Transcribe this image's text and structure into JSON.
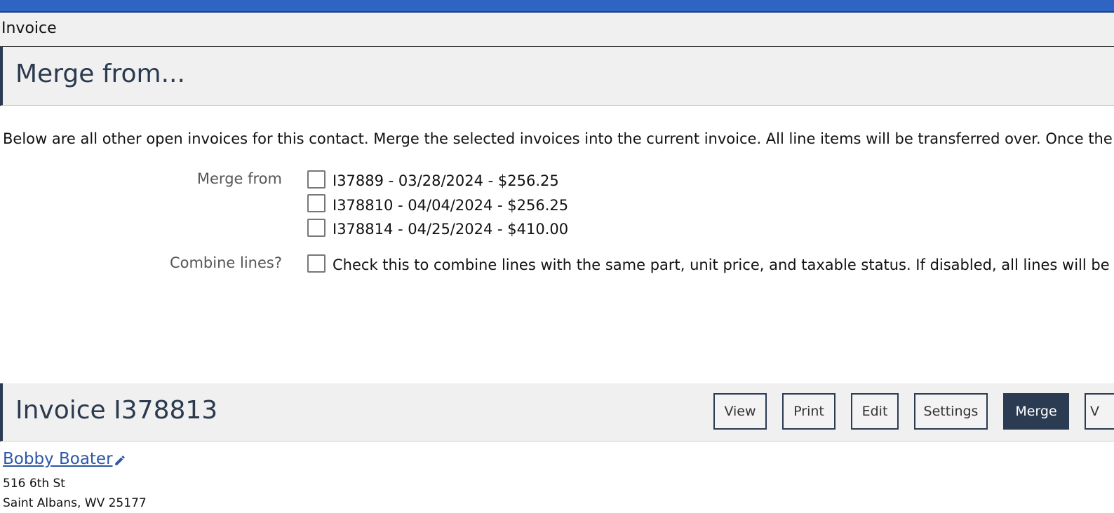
{
  "window": {
    "tab_title": "Invoice"
  },
  "merge_section": {
    "title": "Merge from...",
    "description": "Below are all other open invoices for this contact. Merge the selected invoices into the current invoice. All line items will be transferred over. Once the mer",
    "merge_from_label": "Merge from",
    "invoices": [
      {
        "label": "I37889 - 03/28/2024 - $256.25",
        "checked": false
      },
      {
        "label": "I378810 - 04/04/2024 - $256.25",
        "checked": false
      },
      {
        "label": "I378814 - 04/25/2024 - $410.00",
        "checked": false
      }
    ],
    "combine_label": "Combine lines?",
    "combine_text": "Check this to combine lines with the same part, unit price, and taxable status. If disabled, all lines will be ad"
  },
  "invoice_section": {
    "title": "Invoice I378813",
    "buttons": {
      "view": "View",
      "print": "Print",
      "edit": "Edit",
      "settings": "Settings",
      "merge": "Merge",
      "partial": "V"
    }
  },
  "contact": {
    "name": "Bobby Boater",
    "address_line1": "516 6th St",
    "address_line2": "Saint Albans, WV 25177"
  },
  "colors": {
    "topbar": "#2e65c3",
    "header_accent": "#2b3b52",
    "link": "#2c56a8"
  }
}
